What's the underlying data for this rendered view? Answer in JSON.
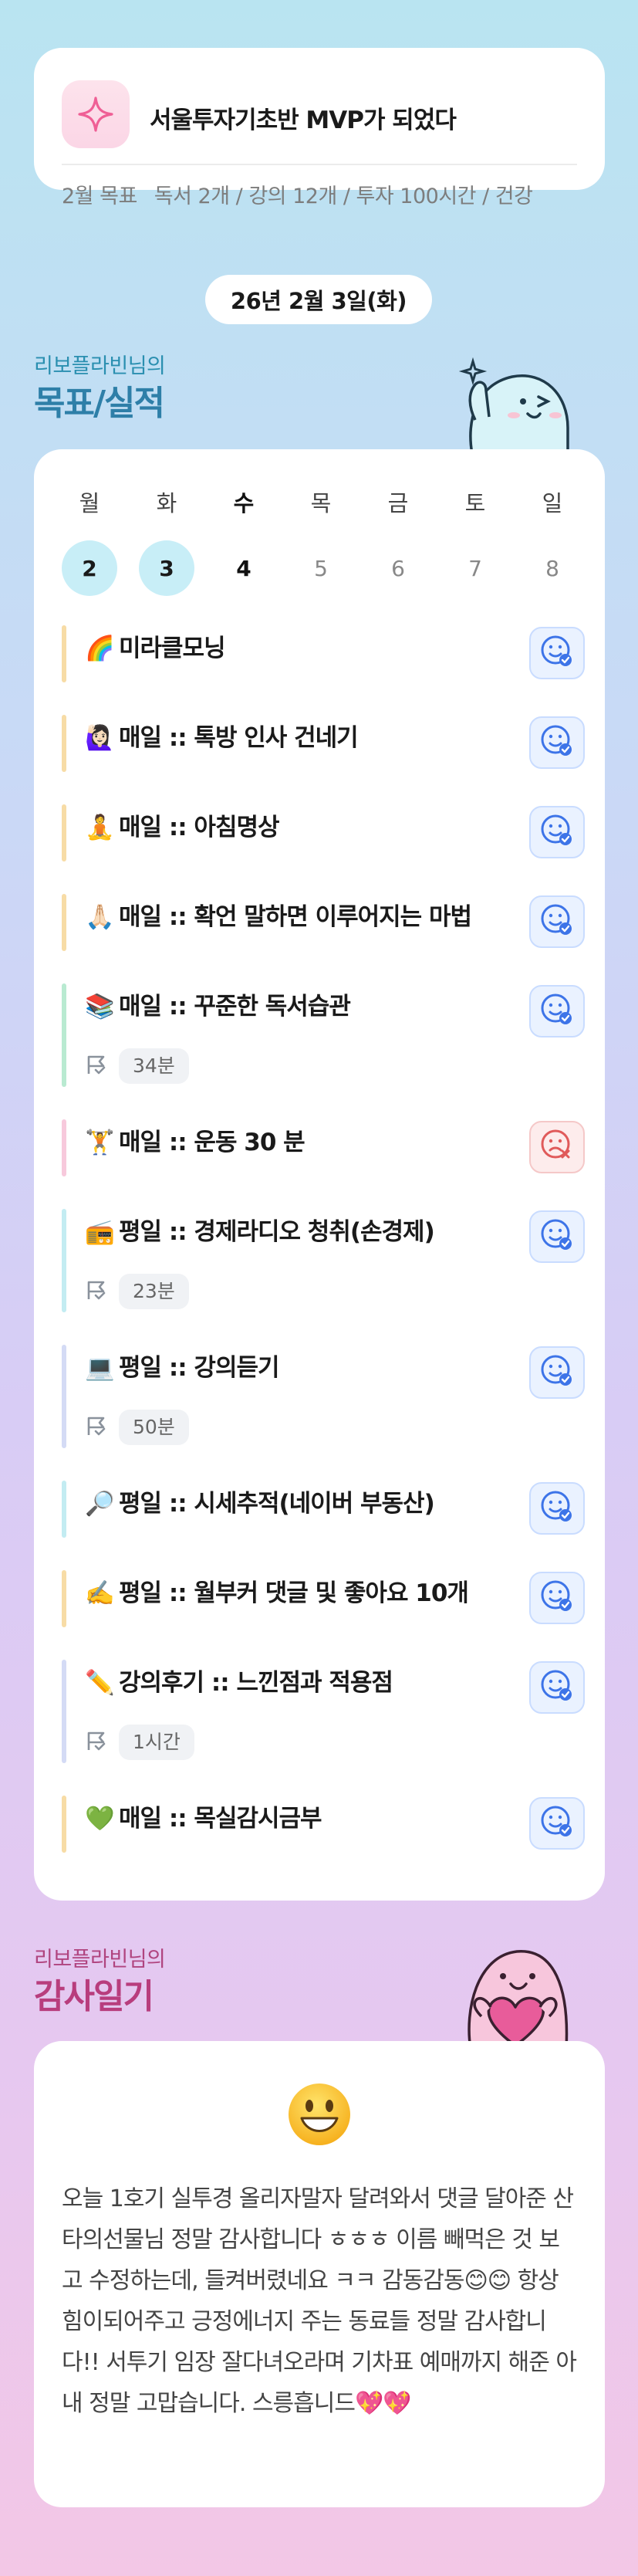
{
  "goal": {
    "title": "서울투자기초반 MVP가 되었다",
    "month_label": "2월 목표",
    "targets": "독서 2개 / 강의 12개 / 투자 100시간 / 건강",
    "icon": "sparkle-icon"
  },
  "date": "26년 2월 3일(화)",
  "tasks_section": {
    "owner": "리보플라빈님의",
    "title": "목표/실적"
  },
  "week": {
    "days": [
      {
        "name": "월",
        "num": "2",
        "state": "done"
      },
      {
        "name": "화",
        "num": "3",
        "state": "done"
      },
      {
        "name": "수",
        "num": "4",
        "state": "today"
      },
      {
        "name": "목",
        "num": "5",
        "state": "future"
      },
      {
        "name": "금",
        "num": "6",
        "state": "future"
      },
      {
        "name": "토",
        "num": "7",
        "state": "future"
      },
      {
        "name": "일",
        "num": "8",
        "state": "future"
      }
    ]
  },
  "tasks": [
    {
      "emoji": "🌈",
      "label": "미라클모닝",
      "bar": "#f7dca6",
      "status": "check",
      "time": ""
    },
    {
      "emoji": "🙋🏻‍♀️",
      "label": "매일 :: 톡방 인사 건네기",
      "bar": "#f7dca6",
      "status": "check",
      "time": ""
    },
    {
      "emoji": "🧘",
      "label": "매일 :: 아침명상",
      "bar": "#f7dca6",
      "status": "check",
      "time": ""
    },
    {
      "emoji": "🙏🏻",
      "label": "매일 :: 확언 말하면 이루어지는 마법",
      "bar": "#f7dca6",
      "status": "check",
      "time": ""
    },
    {
      "emoji": "📚",
      "label": "매일 :: 꾸준한 독서습관",
      "bar": "#b9ead1",
      "status": "check",
      "time": "34분"
    },
    {
      "emoji": "🏋️",
      "label": "매일 :: 운동 30 분",
      "bar": "#f7c9dc",
      "status": "fail",
      "time": ""
    },
    {
      "emoji": "📻",
      "label": "평일 :: 경제라디오 청취(손경제)",
      "bar": "#c3ecf2",
      "status": "check",
      "time": "23분"
    },
    {
      "emoji": "💻",
      "label": "평일 :: 강의듣기",
      "bar": "#d4dbf5",
      "status": "check",
      "time": "50분"
    },
    {
      "emoji": "🔎",
      "label": "평일 :: 시세추적(네이버 부동산)",
      "bar": "#c3ecf2",
      "status": "check",
      "time": ""
    },
    {
      "emoji": "✍️",
      "label": "평일 :: 월부커 댓글 및 좋아요 10개",
      "bar": "#f7dca6",
      "status": "check",
      "time": ""
    },
    {
      "emoji": "✏️",
      "label": "강의후기 :: 느낀점과 적용점",
      "bar": "#d4dbf5",
      "status": "check",
      "time": "1시간"
    },
    {
      "emoji": "💚",
      "label": "매일 :: 목실감시금부",
      "bar": "#f7dca6",
      "status": "check",
      "time": ""
    }
  ],
  "gratitude_section": {
    "owner": "리보플라빈님의",
    "title": "감사일기",
    "emoji": "😀",
    "text": "오늘 1호기 실투경 올리자말자 달려와서 댓글 달아준 산타의선물님 정말 감사합니다 ㅎㅎㅎ 이름 빼먹은 것 보고 수정하는데, 들켜버렸네요 ㅋㅋ 감동감동😊😊 항상 힘이되어주고 긍정에너지 주는 동료들 정말 감사합니다!! 서투기 임장 잘다녀오라며 기차표 예매까지 해준 아내 정말 고맙습니다. 스릉흡니드💖💖"
  },
  "colors": {
    "accent_blue": "#2e7fa8",
    "accent_pink": "#b83d7d",
    "done_day": "#c8eef7",
    "check_button": "#eaf2ff",
    "fail_button": "#fdecec"
  }
}
